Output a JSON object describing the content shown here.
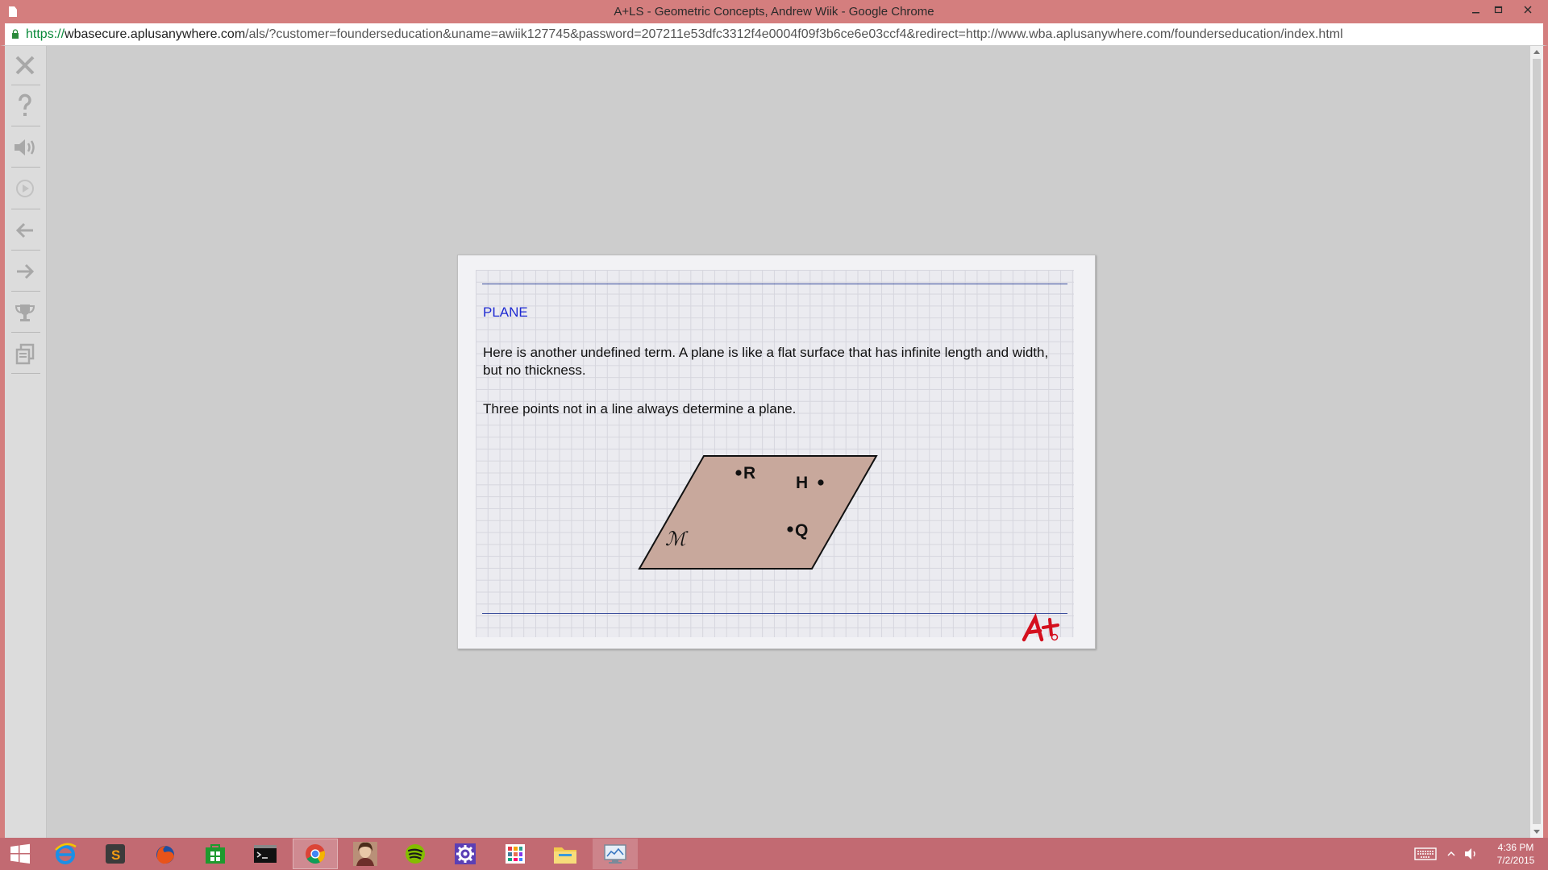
{
  "window": {
    "title": "A+LS - Geometric Concepts, Andrew Wiik - Google Chrome",
    "controls": [
      "minimize",
      "maximize",
      "close"
    ]
  },
  "address_bar": {
    "scheme": "https://",
    "host": "wbasecure.aplusanywhere.com",
    "path": "/als/?customer=founderseducation&uname=awiik127745&password=207211e53dfc3312f4e0004f09f3b6ce6e03ccf4&redirect=http://www.wba.aplusanywhere.com/founderseducation/index.html"
  },
  "sidebar": {
    "tools": [
      {
        "name": "close",
        "icon": "close-icon"
      },
      {
        "name": "help",
        "icon": "question-icon"
      },
      {
        "name": "audio",
        "icon": "speaker-icon"
      },
      {
        "name": "play",
        "icon": "play-icon"
      },
      {
        "name": "back",
        "icon": "arrow-left-icon"
      },
      {
        "name": "forward",
        "icon": "arrow-right-icon"
      },
      {
        "name": "trophy",
        "icon": "trophy-icon"
      },
      {
        "name": "glossary",
        "icon": "pages-icon"
      }
    ]
  },
  "lesson": {
    "heading": "PLANE",
    "paragraph1": "Here is another undefined term. A plane is like a flat surface that has infinite length and width, but no thickness.",
    "paragraph2": "Three points not in a line always determine a plane.",
    "diagram": {
      "plane_label": "ℳ",
      "points": [
        "R",
        "H",
        "Q"
      ],
      "fill_color": "#c8a89c"
    },
    "logo": "A+"
  },
  "taskbar": {
    "apps": [
      "start",
      "internet-explorer",
      "sublime-text",
      "firefox",
      "store",
      "command-prompt",
      "chrome",
      "photo",
      "spotify",
      "settings",
      "apps",
      "file-explorer",
      "remote-desktop"
    ],
    "clock": {
      "time": "4:36 PM",
      "date": "7/2/2015"
    }
  },
  "colors": {
    "titlebar": "#d47e7e",
    "taskbar": "#c26a72",
    "heading": "#1e2ad1",
    "rule": "#3a4d9c"
  }
}
